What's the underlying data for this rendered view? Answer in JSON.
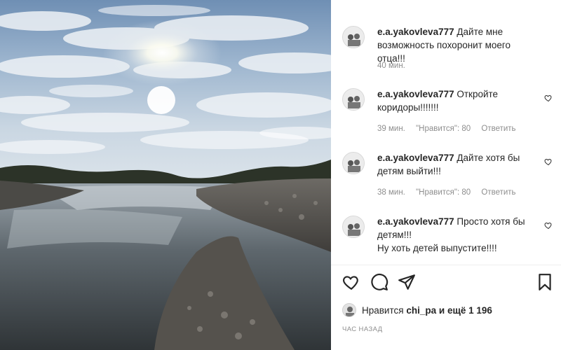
{
  "comments": [
    {
      "username": "e.a.yakovleva777",
      "text": "Дайте мне возможность похоронит моего отца!!!",
      "time": "40 мин.",
      "likes_label": "",
      "reply_label": ""
    },
    {
      "username": "e.a.yakovleva777",
      "text": "Откройте коридоры!!!!!!!",
      "time": "39 мин.",
      "likes_label": "\"Нравится\": 80",
      "reply_label": "Ответить"
    },
    {
      "username": "e.a.yakovleva777",
      "text": "Дайте хотя бы детям выйти!!!",
      "time": "38 мин.",
      "likes_label": "\"Нравится\": 80",
      "reply_label": "Ответить"
    },
    {
      "username": "e.a.yakovleva777",
      "text": "Просто хотя бы детям!!!\nНу хоть детей выпустите!!!!",
      "time": "",
      "likes_label": "",
      "reply_label": ""
    }
  ],
  "likes": {
    "prefix": "Нравится",
    "user": "chi_pa",
    "suffix": "и ещё 1 196"
  },
  "post_time": "ЧАС НАЗАД",
  "icons": {
    "like": "heart-icon",
    "comment": "comment-icon",
    "share": "share-icon",
    "save": "bookmark-icon"
  }
}
